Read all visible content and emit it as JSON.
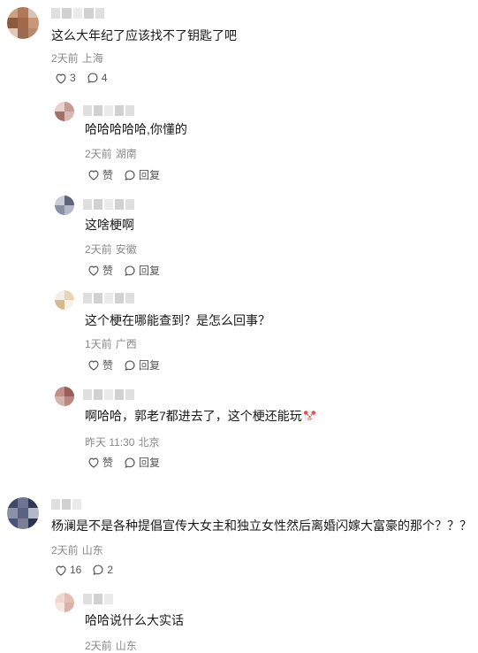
{
  "comments": [
    {
      "text": "这么大年纪了应该找不了钥匙了吧",
      "time": "2天前",
      "location": "上海",
      "likes": "3",
      "replies_count": "4",
      "avatar_colors": [
        "#caa27f",
        "#b07a58",
        "#d9c3b2",
        "#8c5b3e",
        "#a06a4a",
        "#c89878",
        "#e0c8b5",
        "#9b6a4f",
        "#b58a6d"
      ]
    },
    {
      "text": "哈哈哈哈哈,你懂的",
      "time": "2天前",
      "location": "湖南",
      "like_label": "赞",
      "reply_label": "回复",
      "avatar_colors": [
        "#e8d2cd",
        "#c69c94",
        "#a0706a",
        "#d8b8b2"
      ]
    },
    {
      "text": "这啥梗啊",
      "time": "2天前",
      "location": "安徽",
      "like_label": "赞",
      "reply_label": "回复",
      "avatar_colors": [
        "#c9ced8",
        "#5e6578",
        "#8a90a4",
        "#b3b8c6"
      ]
    },
    {
      "text": "这个梗在哪能查到？是怎么回事？",
      "time": "1天前",
      "location": "广西",
      "like_label": "赞",
      "reply_label": "回复",
      "avatar_colors": [
        "#f4ede5",
        "#e9d3b4",
        "#d7b98e",
        "#f6f1ea"
      ]
    },
    {
      "text": "啊哈哈，郭老7都进去了，这个梗还能玩",
      "time": "昨天 11:30",
      "location": "北京",
      "like_label": "赞",
      "reply_label": "回复",
      "emoji": "clown-face",
      "avatar_colors": [
        "#c48f8a",
        "#9a5e58",
        "#d7b3ad",
        "#b98780"
      ]
    },
    {
      "text": "杨澜是不是各种提倡宣传大女主和独立女性然后离婚闪嫁大富豪的那个？？？",
      "time": "2天前",
      "location": "山东",
      "likes": "16",
      "replies_count": "2",
      "avatar_colors": [
        "#3f4a6b",
        "#6c7690",
        "#2f3856",
        "#8b90a6",
        "#5a6282",
        "#b4b8c8",
        "#48527a",
        "#7a7f96",
        "#2c3350"
      ]
    },
    {
      "text": "哈哈说什么大实话",
      "time": "2天前",
      "location": "山东",
      "avatar_colors": [
        "#f1d7cf",
        "#e6bfb4",
        "#f6e6e0",
        "#dcb2a6"
      ]
    }
  ],
  "colors": {
    "text": "#191919",
    "meta": "#8a8a8a",
    "icon": "#555555"
  },
  "icons": {
    "like": "heart-outline-icon",
    "reply": "speech-bubble-icon"
  }
}
